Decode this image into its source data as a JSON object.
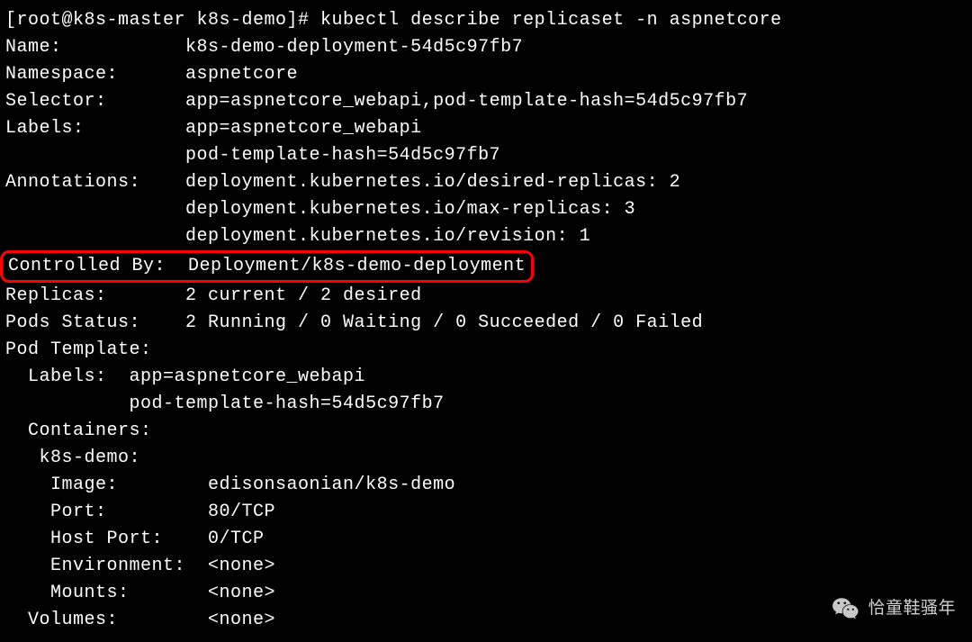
{
  "prompt": "[root@k8s-master k8s-demo]# kubectl describe replicaset -n aspnetcore",
  "fields": {
    "name": "Name:           k8s-demo-deployment-54d5c97fb7",
    "namespace": "Namespace:      aspnetcore",
    "selector": "Selector:       app=aspnetcore_webapi,pod-template-hash=54d5c97fb7",
    "labels1": "Labels:         app=aspnetcore_webapi",
    "labels2": "                pod-template-hash=54d5c97fb7",
    "annotations1": "Annotations:    deployment.kubernetes.io/desired-replicas: 2",
    "annotations2": "                deployment.kubernetes.io/max-replicas: 3",
    "annotations3": "                deployment.kubernetes.io/revision: 1",
    "controlledBy": "Controlled By:  Deployment/k8s-demo-deployment",
    "replicas": "Replicas:       2 current / 2 desired",
    "podsStatus": "Pods Status:    2 Running / 0 Waiting / 0 Succeeded / 0 Failed",
    "podTemplate": "Pod Template:",
    "ptLabels1": "  Labels:  app=aspnetcore_webapi",
    "ptLabels2": "           pod-template-hash=54d5c97fb7",
    "containers": "  Containers:",
    "containerName": "   k8s-demo:",
    "image": "    Image:        edisonsaonian/k8s-demo",
    "port": "    Port:         80/TCP",
    "hostPort": "    Host Port:    0/TCP",
    "environment": "    Environment:  <none>",
    "mounts": "    Mounts:       <none>",
    "volumes": "  Volumes:        <none>"
  },
  "watermark": {
    "text": "恰童鞋骚年"
  }
}
